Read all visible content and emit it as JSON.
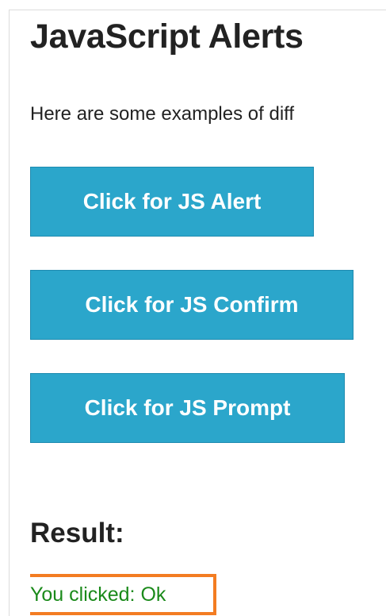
{
  "page": {
    "title": "JavaScript Alerts",
    "intro": "Here are some examples of diff"
  },
  "buttons": {
    "alert_label": "Click for JS Alert",
    "confirm_label": "Click for JS Confirm",
    "prompt_label": "Click for JS Prompt"
  },
  "result": {
    "heading": "Result:",
    "text": "You clicked: Ok"
  },
  "colors": {
    "button_bg": "#2ba6cb",
    "result_text": "#1a8a1a",
    "highlight_border": "#f37c22"
  }
}
